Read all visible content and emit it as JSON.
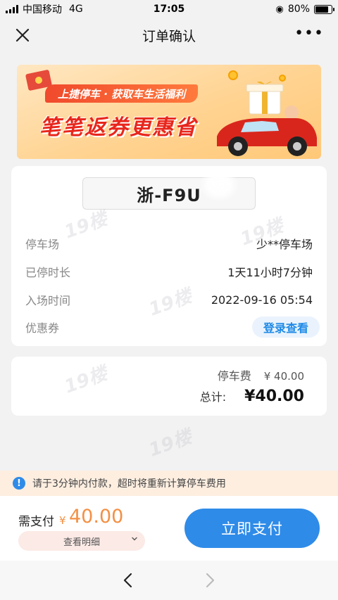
{
  "status_bar": {
    "carrier": "中国移动",
    "network": "4G",
    "time": "17:05",
    "battery": "80%",
    "battery_level": 0.8
  },
  "nav": {
    "title": "订单确认",
    "more": "•••"
  },
  "banner": {
    "tagline": "上捷停车 · 获取车生活福利",
    "headline": "笔笔返券更惠省"
  },
  "order": {
    "plate": "浙-F9U",
    "rows": [
      {
        "label": "停车场",
        "value": "少**停车场"
      },
      {
        "label": "已停时长",
        "value": "1天11小时7分钟"
      },
      {
        "label": "入场时间",
        "value": "2022-09-16 05:54"
      },
      {
        "label": "优惠券",
        "action": "登录查看"
      }
    ]
  },
  "fees": {
    "parking_label": "停车费",
    "parking_amount": "¥ 40.00",
    "total_label": "总计:",
    "total_amount": "¥40.00"
  },
  "notice": {
    "icon": "!",
    "text": "请于3分钟内付款，超时将重新计算停车费用"
  },
  "payment": {
    "label": "需支付",
    "currency": "¥",
    "amount": "40.00",
    "details_label": "查看明细",
    "pay_button": "立即支付"
  },
  "watermark": "19楼",
  "colors": {
    "accent_blue": "#2f8be8",
    "amount_orange": "#f39044",
    "banner_red": "#e8261c"
  }
}
